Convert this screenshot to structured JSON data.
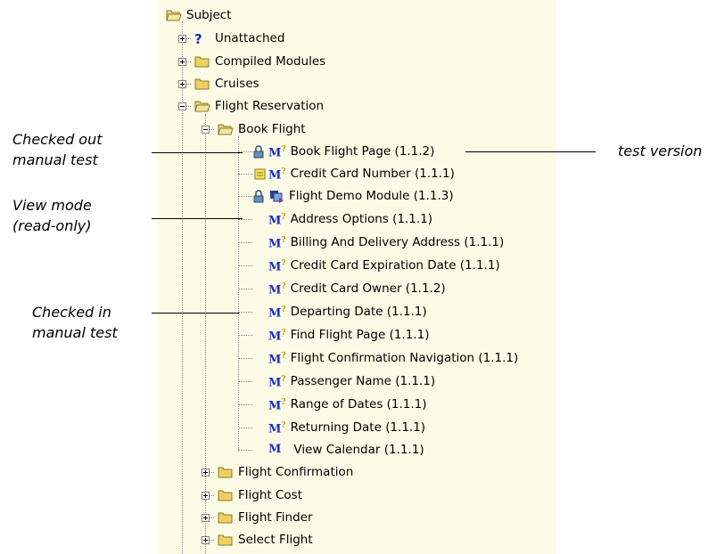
{
  "tree": {
    "root": {
      "label": "Subject",
      "icon": "folder-open-icon"
    },
    "top_level": [
      {
        "label": "Unattached",
        "icon": "question-icon"
      },
      {
        "label": "Compiled Modules",
        "icon": "folder-icon"
      },
      {
        "label": "Cruises",
        "icon": "folder-icon"
      },
      {
        "label": "Flight Reservation",
        "icon": "folder-open-icon"
      }
    ],
    "flight_reservation_children": [
      {
        "label": "Book Flight",
        "icon": "folder-open-icon",
        "expanded": true
      },
      {
        "label": "Flight Confirmation",
        "icon": "folder-icon"
      },
      {
        "label": "Flight Cost",
        "icon": "folder-icon"
      },
      {
        "label": "Flight Finder",
        "icon": "folder-icon"
      },
      {
        "label": "Select Flight",
        "icon": "folder-icon"
      }
    ],
    "book_flight_tests": [
      {
        "label": "Book Flight Page (1.1.2)",
        "status": "checked-out",
        "icon": "manual-test-icon"
      },
      {
        "label": "Credit Card Number (1.1.1)",
        "status": "view-mode",
        "icon": "manual-test-icon"
      },
      {
        "label": "Flight Demo Module (1.1.3)",
        "status": "checked-out",
        "icon": "business-component-icon"
      },
      {
        "label": "Address Options (1.1.1)",
        "icon": "manual-test-icon"
      },
      {
        "label": "Billing And Delivery Address (1.1.1)",
        "icon": "manual-test-icon"
      },
      {
        "label": "Credit Card Expiration Date (1.1.1)",
        "icon": "manual-test-icon"
      },
      {
        "label": "Credit Card Owner (1.1.2)",
        "icon": "manual-test-icon"
      },
      {
        "label": "Departing Date (1.1.1)",
        "icon": "manual-test-icon"
      },
      {
        "label": "Find Flight Page (1.1.1)",
        "icon": "manual-test-icon"
      },
      {
        "label": "Flight Confirmation Navigation (1.1.1)",
        "icon": "manual-test-icon"
      },
      {
        "label": "Passenger Name (1.1.1)",
        "icon": "manual-test-icon"
      },
      {
        "label": "Range of Dates (1.1.1)",
        "icon": "manual-test-icon"
      },
      {
        "label": "Returning Date (1.1.1)",
        "icon": "manual-test-icon"
      },
      {
        "label": "View Calendar (1.1.1)",
        "icon": "module-icon"
      }
    ]
  },
  "annotations": {
    "checked_out": [
      "Checked out",
      "manual test"
    ],
    "view_mode": [
      "View mode",
      "(read-only)"
    ],
    "checked_in": [
      "Checked in",
      "manual test"
    ],
    "test_version": "test version"
  },
  "colors": {
    "panel_background": "#fcfce6",
    "folder_yellow": "#f0d060",
    "test_icon_blue": "#1a2bcc"
  }
}
